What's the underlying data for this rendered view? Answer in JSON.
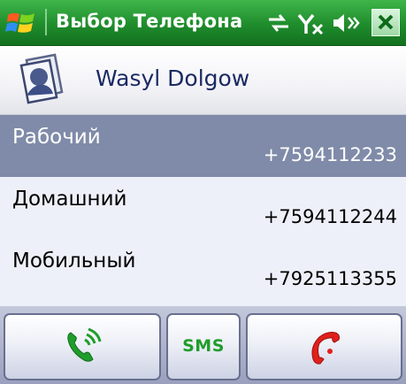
{
  "window": {
    "title": "Выбор Телефона"
  },
  "status_icons": [
    "sync-icon",
    "signal-off-icon",
    "volume-off-icon",
    "close-icon"
  ],
  "contact": {
    "name": "Wasyl Dolgow",
    "icon": "contact-card-icon"
  },
  "phones": [
    {
      "label": "Рабочий",
      "number": "+7594112233",
      "selected": true
    },
    {
      "label": "Домашний",
      "number": "+7594112244",
      "selected": false
    },
    {
      "label": "Мобильный",
      "number": "+7925113355",
      "selected": false
    }
  ],
  "softkeys": {
    "call_icon": "phone-call-icon",
    "sms_label": "SMS",
    "end_icon": "phone-hangup-icon"
  },
  "colors": {
    "titlebar": "#1f8c2c",
    "selected_row": "#7f8ba8",
    "row_bg": "#eef0f9",
    "call_green": "#1f9d2b",
    "end_red": "#e0201b",
    "name_blue": "#1b2a63"
  }
}
